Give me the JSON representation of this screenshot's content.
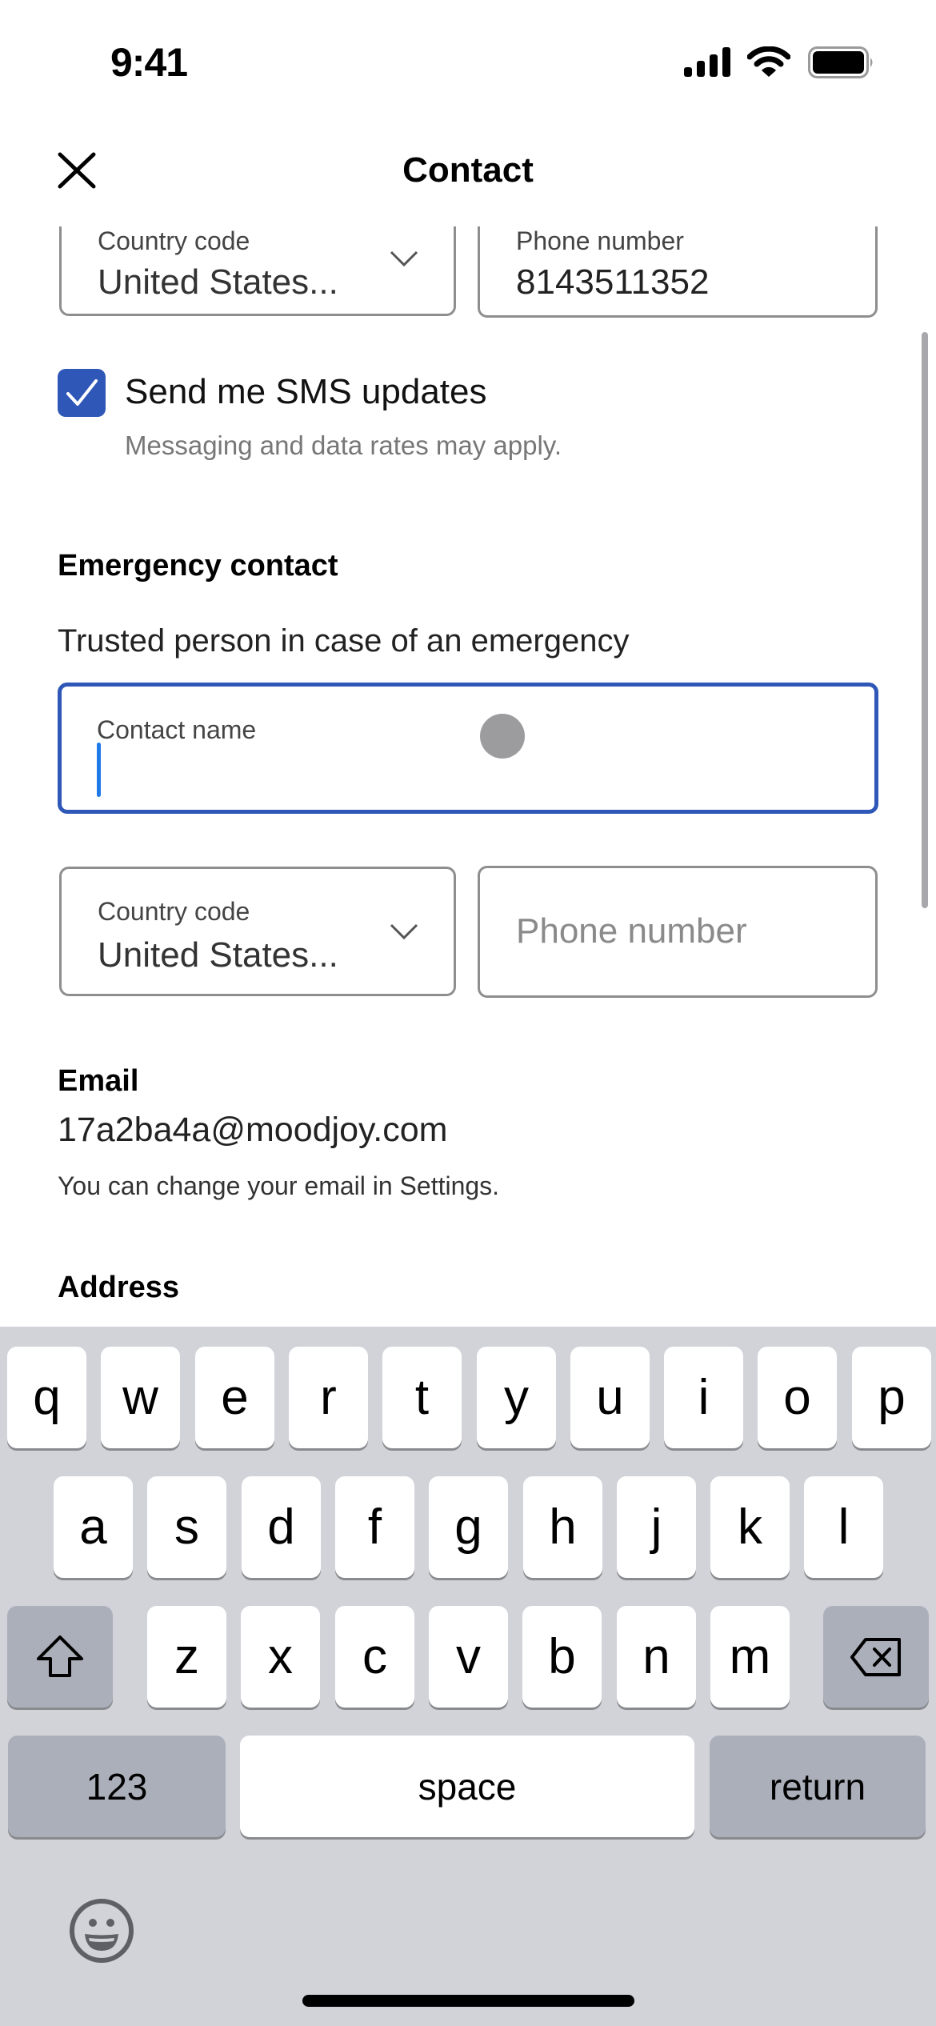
{
  "status_bar": {
    "time": "9:41",
    "icons": [
      "cellular-signal-icon",
      "wifi-icon",
      "battery-icon"
    ]
  },
  "header": {
    "title": "Contact",
    "close_icon": "close-icon"
  },
  "phone_section": {
    "country_code": {
      "label": "Country code",
      "value": "United States..."
    },
    "phone_number": {
      "label": "Phone number",
      "value": "8143511352"
    }
  },
  "sms": {
    "checked": true,
    "label": "Send me SMS updates",
    "help": "Messaging and data rates may apply."
  },
  "emergency_contact": {
    "heading": "Emergency contact",
    "description": "Trusted person in case of an emergency",
    "contact_name": {
      "label": "Contact name",
      "value": ""
    },
    "country_code": {
      "label": "Country code",
      "value": "United States..."
    },
    "phone_number": {
      "placeholder": "Phone number",
      "value": ""
    }
  },
  "email": {
    "heading": "Email",
    "value": "17a2ba4a@moodjoy.com",
    "help": "You can change your email in Settings."
  },
  "address": {
    "heading": "Address"
  },
  "keyboard": {
    "row1": [
      "q",
      "w",
      "e",
      "r",
      "t",
      "y",
      "u",
      "i",
      "o",
      "p"
    ],
    "row2": [
      "a",
      "s",
      "d",
      "f",
      "g",
      "h",
      "j",
      "k",
      "l"
    ],
    "row3": [
      "z",
      "x",
      "c",
      "v",
      "b",
      "n",
      "m"
    ],
    "shift_icon": "shift-icon",
    "delete_icon": "delete-icon",
    "numbers_label": "123",
    "space_label": "space",
    "return_label": "return",
    "emoji_icon": "emoji-icon"
  },
  "colors": {
    "accent": "#2F57B8",
    "caret": "#1F7AE8",
    "keyboard_bg": "#D1D3D9",
    "modifier_key": "#ABAFBA"
  }
}
